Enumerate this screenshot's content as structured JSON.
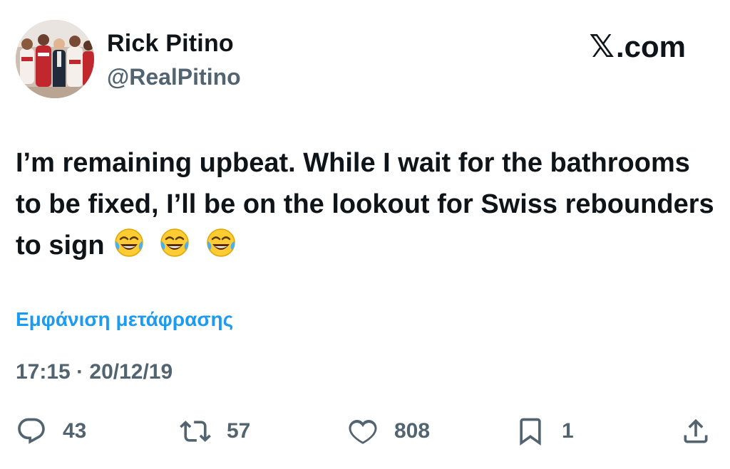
{
  "user": {
    "name": "Rick Pitino",
    "handle": "@RealPitino"
  },
  "brand": {
    "x_glyph": "𝕏",
    "label": ".com"
  },
  "tweet": {
    "text": "I’m remaining upbeat. While I wait for the bathrooms to be fixed, I’ll be on the lookout for Swiss rebounders to sign",
    "emojis": [
      "face-with-tears-of-joy",
      "face-with-tears-of-joy",
      "face-with-tears-of-joy"
    ]
  },
  "translate_link": "Εμφάνιση μετάφρασης",
  "timestamp": "17:15 · 20/12/19",
  "actions": {
    "replies": "43",
    "retweets": "57",
    "likes": "808",
    "bookmarks": "1"
  },
  "colors": {
    "text": "#0f1419",
    "secondary": "#536471",
    "link": "#1d9bf0"
  }
}
